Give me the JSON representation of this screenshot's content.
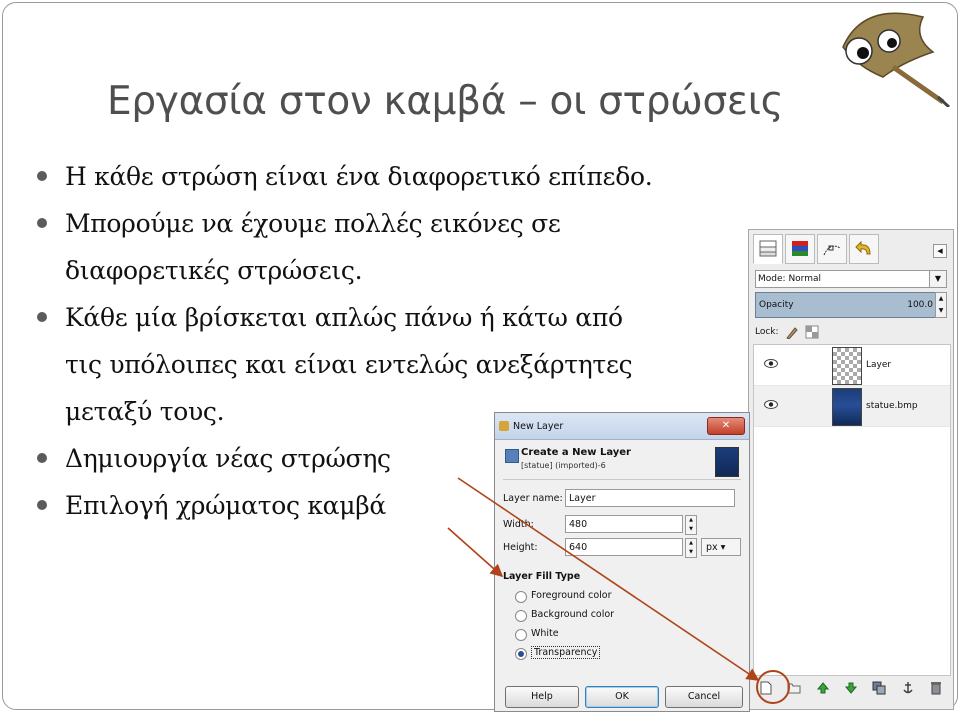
{
  "slide": {
    "title": "Εργασία στον καμβά – οι στρώσεις",
    "bullets": [
      "Η κάθε στρώση είναι ένα διαφορετικό επίπεδο.",
      "Μπορούμε να έχουμε πολλές εικόνες σε διαφορετικές στρώσεις.",
      "Κάθε μία βρίσκεται απλώς πάνω ή κάτω από τις υπόλοιπες και είναι εντελώς ανεξάρτητες μεταξύ τους.",
      "Δημιουργία νέας στρώσης",
      "Επιλογή χρώματος καμβά"
    ],
    "bullet_lines": [
      [
        "Η κάθε στρώση είναι ένα διαφορετικό επίπεδο."
      ],
      [
        "Μπορούμε να έχουμε πολλές εικόνες σε",
        "διαφορετικές στρώσεις."
      ],
      [
        "Κάθε μία βρίσκεται απλώς πάνω ή κάτω από",
        "τις υπόλοιπες και είναι εντελώς ανεξάρτητες",
        "μεταξύ τους."
      ],
      [
        "Δημιουργία νέας στρώσης"
      ],
      [
        "Επιλογή χρώματος καμβά"
      ]
    ]
  },
  "layers_panel": {
    "mode_label": "Mode:",
    "mode_value": "Normal",
    "opacity_label": "Opacity",
    "opacity_value": "100.0",
    "lock_label": "Lock:",
    "layers": [
      {
        "name": "Layer",
        "thumb": "transparent"
      },
      {
        "name": "statue.bmp",
        "thumb": "image"
      }
    ]
  },
  "new_layer_dialog": {
    "window_title": "New Layer",
    "close_label": "✕",
    "heading": "Create a New Layer",
    "subheading": "[statue] (imported)-6",
    "layer_name_label": "Layer name:",
    "layer_name_value": "Layer",
    "width_label": "Width:",
    "width_value": "480",
    "height_label": "Height:",
    "height_value": "640",
    "unit_value": "px",
    "fill_type_title": "Layer Fill Type",
    "fill_options": [
      "Foreground color",
      "Background color",
      "White",
      "Transparency"
    ],
    "selected_fill": "Transparency",
    "help_label": "Help",
    "ok_label": "OK",
    "cancel_label": "Cancel"
  },
  "colors": {
    "accent_arrow": "#b0431b",
    "opacity_bar": "#a9bdd1",
    "title_text": "#4f4f4f"
  },
  "icons": {
    "tabs": [
      "layers-tab-icon",
      "channels-tab-icon",
      "paths-tab-icon",
      "undo-tab-icon"
    ],
    "lock": [
      "lock-paint-icon",
      "lock-alpha-icon"
    ],
    "bottom_bar": [
      "new-layer-icon",
      "new-layer-group-icon",
      "raise-layer-icon",
      "lower-layer-icon",
      "duplicate-layer-icon",
      "anchor-layer-icon",
      "delete-layer-icon"
    ]
  }
}
